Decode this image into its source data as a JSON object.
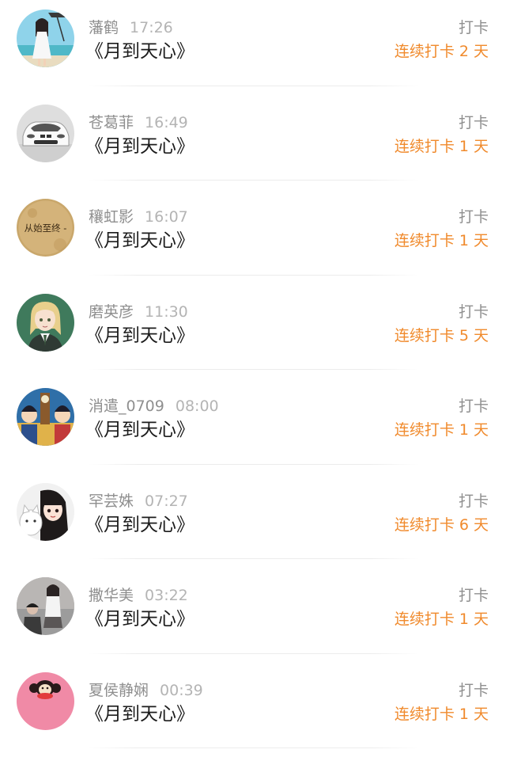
{
  "entries": [
    {
      "name": "藩鹤",
      "time": "17:26",
      "book": "《月到天心》",
      "action": "打卡",
      "streak": "连续打卡 2 天",
      "avatar": "girl-beach-avatar"
    },
    {
      "name": "苍葛菲",
      "time": "16:49",
      "book": "《月到天心》",
      "action": "打卡",
      "streak": "连续打卡 1 天",
      "avatar": "white-car-avatar"
    },
    {
      "name": "穰虹影",
      "time": "16:07",
      "book": "《月到天心》",
      "action": "打卡",
      "streak": "连续打卡 1 天",
      "avatar": "text-badge-avatar",
      "avatar_text": "从始至终 -"
    },
    {
      "name": "磨英彦",
      "time": "11:30",
      "book": "《月到天心》",
      "action": "打卡",
      "streak": "连续打卡 5 天",
      "avatar": "anime-girl-green-avatar"
    },
    {
      "name": "消遣_0709",
      "time": "08:00",
      "book": "《月到天心》",
      "action": "打卡",
      "streak": "连续打卡 1 天",
      "avatar": "anime-characters-avatar"
    },
    {
      "name": "罕芸姝",
      "time": "07:27",
      "book": "《月到天心》",
      "action": "打卡",
      "streak": "连续打卡 6 天",
      "avatar": "cartoon-girl-cat-avatar"
    },
    {
      "name": "撒华美",
      "time": "03:22",
      "book": "《月到天心》",
      "action": "打卡",
      "streak": "连续打卡 1 天",
      "avatar": "photo-people-avatar"
    },
    {
      "name": "夏侯静娴",
      "time": "00:39",
      "book": "《月到天心》",
      "action": "打卡",
      "streak": "连续打卡 1 天",
      "avatar": "monkey-pink-avatar"
    }
  ],
  "colors": {
    "accent": "#f08a2c",
    "name_text": "#8f8f8f",
    "time_text": "#b4b4b4",
    "title_text": "#1c1c1c",
    "divider": "#ececec"
  }
}
